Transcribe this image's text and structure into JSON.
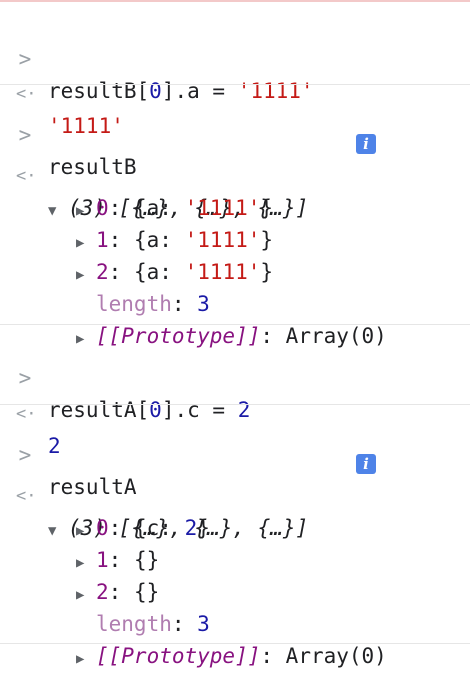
{
  "colors": {
    "string": "#c41a16",
    "number": "#1a1aa6",
    "property": "#881280",
    "length_property": "#b07db0",
    "info_badge": "#4e83e8"
  },
  "icons": {
    "prompt": "chevron-right-icon",
    "result": "return-arrow-icon",
    "expand": "triangle-down-icon",
    "collapse": "triangle-right-icon",
    "info": "info-icon"
  },
  "glyphs": {
    "prompt": ">",
    "result": "<·",
    "expanded": "▼",
    "collapsed": "▶",
    "info": "i"
  },
  "entries": [
    {
      "input": {
        "obj": "resultB",
        "idx": "0",
        "prop": "a",
        "op": " = ",
        "value": "'1111'"
      },
      "result": "'1111'"
    },
    {
      "input": "resultB",
      "summary": "(3) [{…}, {…}, {…}]",
      "items": [
        {
          "key": "0",
          "open": "{",
          "pkey": "a",
          "pval": "'1111'",
          "close": "}"
        },
        {
          "key": "1",
          "open": "{",
          "pkey": "a",
          "pval": "'1111'",
          "close": "}"
        },
        {
          "key": "2",
          "open": "{",
          "pkey": "a",
          "pval": "'1111'",
          "close": "}"
        }
      ],
      "length_label": "length",
      "length_value": "3",
      "proto_label": "[[Prototype]]",
      "proto_value": "Array(0)"
    },
    {
      "input": {
        "obj": "resultA",
        "idx": "0",
        "prop": "c",
        "op": " = ",
        "value": "2"
      },
      "result": "2"
    },
    {
      "input": "resultA",
      "summary": "(3) [{…}, {…}, {…}]",
      "items": [
        {
          "key": "0",
          "open": "{",
          "pkey": "c",
          "pval": "2",
          "close": "}"
        },
        {
          "key": "1",
          "text": "{}"
        },
        {
          "key": "2",
          "text": "{}"
        }
      ],
      "length_label": "length",
      "length_value": "3",
      "proto_label": "[[Prototype]]",
      "proto_value": "Array(0)"
    }
  ]
}
